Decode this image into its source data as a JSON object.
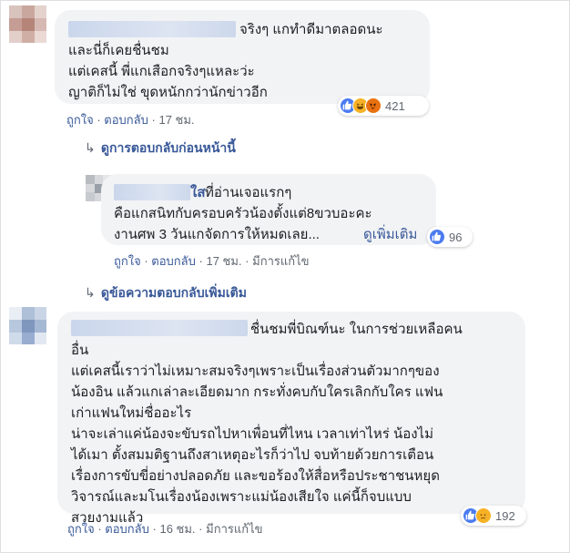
{
  "comments": [
    {
      "lines": [
        "จริงๆ แกทำดีมาตลอดนะ",
        "และนี่ก็เคยชื่นชม",
        "แต่เคสนี้ พี่แกเสือกจริงๆแหละว่ะ",
        "ญาติก็ไม่ใช่ ขุดหนักกว่านักข่าวอีก"
      ],
      "reaction_count": "421",
      "reaction_icons": [
        "like-icon",
        "haha-icon",
        "angry-icon"
      ],
      "actions": {
        "like": "ถูกใจ",
        "reply": "ตอบกลับ",
        "time": "17 ชม."
      }
    }
  ],
  "previous_replies_label": "ดูการตอบกลับก่อนหน้านี้",
  "reply": {
    "name_partial": "ใส",
    "lines": [
      "ที่อ่านเจอแรกๆ",
      "คือแกสนิทกับครอบครัวน้องตั้งแต่8ขวบอะคะ",
      "งานศพ 3 วันแกจัดการให้หมดเลย..."
    ],
    "see_more": "ดูเพิ่มเติม",
    "reaction_count": "96",
    "reaction_icons": [
      "like-icon"
    ],
    "actions": {
      "like": "ถูกใจ",
      "reply": "ตอบกลับ",
      "time": "17 ชม.",
      "edited": "มีการแก้ไข"
    }
  },
  "more_replies_label": "ดูข้อความตอบกลับเพิ่มเติม",
  "comment2": {
    "lines": [
      "ชื่นชมพี่บิณฑ์นะ ในการช่วยเหลือคน",
      "อื่น",
      "แต่เคสนี้เราว่าไม่เหมาะสมจริงๆเพราะเป็นเรื่องส่วนตัวมากๆของ",
      "น้องอิน แล้วแกเล่าละเอียดมาก กระทั่งคบกับใครเลิกกับใคร แฟน",
      "เก่าแฟนใหม่ชื่ออะไร",
      "น่าจะเล่าแค่น้องจะขับรถไปหาเพื่อนที่ไหน เวลาเท่าไหร่ น้องไม่",
      "ได้เมา ตั้งสมมติฐานถึงสาเหตุอะไรก็ว่าไป จบท้ายด้วยการเตือน",
      "เรื่องการขับขี่อย่างปลอดภัย และขอร้องให้สื่อหรือประชาชนหยุด",
      "วิจารณ์และมโนเรื่องน้องเพราะแม่น้องเสียใจ แค่นี้ก็จบแบบ",
      "สวยงามแล้ว"
    ],
    "reaction_count": "192",
    "reaction_icons": [
      "like-icon",
      "sad-icon"
    ],
    "actions": {
      "like": "ถูกใจ",
      "reply": "ตอบกลับ",
      "time": "16 ชม.",
      "edited": "มีการแก้ไข"
    }
  },
  "colors": {
    "link": "#385898",
    "bubble": "#f2f3f5",
    "meta": "#606770",
    "like": "#4a7bf0",
    "angry": "#e9710f",
    "emoji": "#f7b125"
  }
}
